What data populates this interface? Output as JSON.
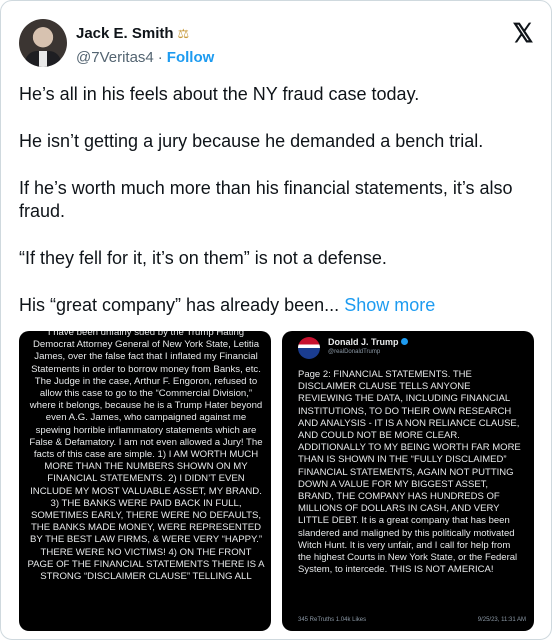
{
  "header": {
    "name": "Jack E. Smith",
    "name_icon": "scales-icon",
    "handle": "@7Veritas4",
    "separator": "·",
    "follow_label": "Follow",
    "logo": "x-logo"
  },
  "tweet": {
    "paragraphs": [
      "He’s all in his feels about the NY fraud case today.",
      "He isn’t getting a jury because he demanded a bench trial.",
      "If he’s worth much more than his financial statements, it’s also fraud.",
      "“If they fell for it, it’s on them” is not a defense."
    ],
    "last_line": "His “great company” has already been...",
    "show_more": "Show more"
  },
  "media": {
    "left_text": "I have been unfairly sued by the Trump Hating Democrat Attorney General of New York State, Letitia James, over the false fact that I inflated my Financial Statements in order to borrow money from Banks, etc. The Judge in the case, Arthur F. Engoron, refused to allow this case to go to the “Commercial Division,” where it belongs, because he is a Trump Hater beyond even A.G. James, who campaigned against me spewing horrible inflammatory statements which are False & Defamatory. I am not even allowed a Jury! The facts of this case are simple. 1) I AM WORTH MUCH MORE THAN THE NUMBERS SHOWN ON MY FINANCIAL STATEMENTS. 2) I DIDN’T EVEN INCLUDE MY MOST VALUABLE ASSET, MY BRAND. 3) THE BANKS WERE PAID BACK IN FULL, SOMETIMES EARLY, THERE WERE NO DEFAULTS, THE BANKS MADE MONEY, WERE REPRESENTED BY THE BEST LAW FIRMS, & WERE VERY “HAPPY.” THERE WERE NO VICTIMS! 4) ON THE FRONT PAGE OF THE FINANCIAL STATEMENTS THERE IS A STRONG “DISCLAIMER CLAUSE” TELLING ALL",
    "right_name": "Donald J. Trump",
    "right_handle": "@realDonaldTrump",
    "right_text": "Page 2: FINANCIAL STATEMENTS. THE DISCLAIMER CLAUSE TELLS ANYONE REVIEWING THE DATA, INCLUDING FINANCIAL INSTITUTIONS, TO DO THEIR OWN RESEARCH AND ANALYSIS - IT IS A NON RELIANCE CLAUSE, AND COULD NOT BE MORE CLEAR. ADDITIONALLY TO MY BEING WORTH FAR MORE THAN IS SHOWN IN THE “FULLY DISCLAIMED” FINANCIAL STATEMENTS, AGAIN NOT PUTTING DOWN A VALUE FOR MY BIGGEST ASSET, BRAND, THE COMPANY HAS HUNDREDS OF MILLIONS OF DOLLARS IN CASH, AND VERY LITTLE DEBT. It is a great company that has been slandered and maligned by this politically motivated Witch Hunt. It is very unfair, and I call for help from the highest Courts in New York State, or the Federal System, to intercede. THIS IS NOT AMERICA!",
    "right_footer_stats": "345 ReTruths  1.04k Likes",
    "right_footer_date": "9/25/23, 11:31 AM"
  }
}
